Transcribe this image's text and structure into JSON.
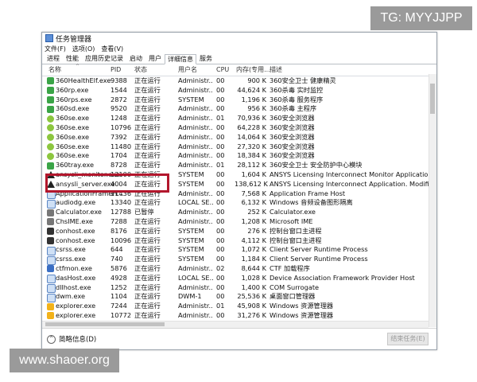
{
  "watermark_top": "TG: MYYJJPP",
  "watermark_bottom": "www.shaoer.org",
  "window": {
    "title": "任务管理器"
  },
  "menu": [
    "文件(F)",
    "选项(O)",
    "查看(V)"
  ],
  "tabs": [
    "进程",
    "性能",
    "应用历史记录",
    "启动",
    "用户",
    "详细信息",
    "服务"
  ],
  "active_tab": "详细信息",
  "columns": {
    "name": "名称",
    "pid": "PID",
    "status": "状态",
    "user": "用户名",
    "cpu": "CPU",
    "mem": "内存(专用...",
    "desc": "描述"
  },
  "rows": [
    {
      "icon": "shield-icon",
      "name": "360HealthElf.exe",
      "pid": "9388",
      "status": "正在运行",
      "user": "Administr...",
      "cpu": "00",
      "mem": "900 K",
      "desc": "360安全卫士 健康精灵"
    },
    {
      "icon": "shield-icon",
      "name": "360rp.exe",
      "pid": "1544",
      "status": "正在运行",
      "user": "Administr...",
      "cpu": "00",
      "mem": "44,624 K",
      "desc": "360杀毒 实时监控"
    },
    {
      "icon": "shield-icon",
      "name": "360rps.exe",
      "pid": "2872",
      "status": "正在运行",
      "user": "SYSTEM",
      "cpu": "00",
      "mem": "1,196 K",
      "desc": "360杀毒 服务程序"
    },
    {
      "icon": "shield-icon",
      "name": "360sd.exe",
      "pid": "9520",
      "status": "正在运行",
      "user": "Administr...",
      "cpu": "00",
      "mem": "956 K",
      "desc": "360杀毒 主程序"
    },
    {
      "icon": "browser-icon",
      "name": "360se.exe",
      "pid": "1248",
      "status": "正在运行",
      "user": "Administr...",
      "cpu": "01",
      "mem": "70,936 K",
      "desc": "360安全浏览器"
    },
    {
      "icon": "browser-icon",
      "name": "360se.exe",
      "pid": "10796",
      "status": "正在运行",
      "user": "Administr...",
      "cpu": "00",
      "mem": "64,228 K",
      "desc": "360安全浏览器"
    },
    {
      "icon": "browser-icon",
      "name": "360se.exe",
      "pid": "7392",
      "status": "正在运行",
      "user": "Administr...",
      "cpu": "00",
      "mem": "14,064 K",
      "desc": "360安全浏览器"
    },
    {
      "icon": "browser-icon",
      "name": "360se.exe",
      "pid": "11480",
      "status": "正在运行",
      "user": "Administr...",
      "cpu": "00",
      "mem": "27,320 K",
      "desc": "360安全浏览器"
    },
    {
      "icon": "browser-icon",
      "name": "360se.exe",
      "pid": "1704",
      "status": "正在运行",
      "user": "Administr...",
      "cpu": "00",
      "mem": "18,384 K",
      "desc": "360安全浏览器"
    },
    {
      "icon": "shield-icon",
      "name": "360tray.exe",
      "pid": "8728",
      "status": "正在运行",
      "user": "Administr...",
      "cpu": "01",
      "mem": "28,112 K",
      "desc": "360安全卫士 安全防护中心模块"
    },
    {
      "icon": "ansys-icon",
      "name": "ansysli_monitor.exe",
      "pid": "12100",
      "status": "正在运行",
      "user": "SYSTEM",
      "cpu": "00",
      "mem": "1,604 K",
      "desc": "ANSYS Licensing Interconnect Monitor Application.  Modif..."
    },
    {
      "icon": "ansys-icon",
      "name": "ansysli_server.exe",
      "pid": "4004",
      "status": "正在运行",
      "user": "SYSTEM",
      "cpu": "00",
      "mem": "138,612 K",
      "desc": "ANSYS Licensing Interconnect Application.  Modified for A..."
    },
    {
      "icon": "window-icon",
      "name": "ApplicationFrameH...",
      "pid": "11436",
      "status": "正在运行",
      "user": "Administr...",
      "cpu": "00",
      "mem": "7,568 K",
      "desc": "Application Frame Host"
    },
    {
      "icon": "window-icon",
      "name": "audiodg.exe",
      "pid": "13340",
      "status": "正在运行",
      "user": "LOCAL SE...",
      "cpu": "00",
      "mem": "6,132 K",
      "desc": "Windows 音频设备图形隔离"
    },
    {
      "icon": "calculator-icon",
      "name": "Calculator.exe",
      "pid": "12788",
      "status": "已暂停",
      "user": "Administr...",
      "cpu": "00",
      "mem": "252 K",
      "desc": "Calculator.exe"
    },
    {
      "icon": "gear-icon",
      "name": "ChsIME.exe",
      "pid": "7288",
      "status": "正在运行",
      "user": "Administr...",
      "cpu": "00",
      "mem": "1,208 K",
      "desc": "Microsoft IME"
    },
    {
      "icon": "console-icon",
      "name": "conhost.exe",
      "pid": "8176",
      "status": "正在运行",
      "user": "SYSTEM",
      "cpu": "00",
      "mem": "276 K",
      "desc": "控制台窗口主进程"
    },
    {
      "icon": "console-icon",
      "name": "conhost.exe",
      "pid": "10096",
      "status": "正在运行",
      "user": "SYSTEM",
      "cpu": "00",
      "mem": "4,112 K",
      "desc": "控制台窗口主进程"
    },
    {
      "icon": "window-icon",
      "name": "csrss.exe",
      "pid": "644",
      "status": "正在运行",
      "user": "SYSTEM",
      "cpu": "00",
      "mem": "1,072 K",
      "desc": "Client Server Runtime Process"
    },
    {
      "icon": "window-icon",
      "name": "csrss.exe",
      "pid": "740",
      "status": "正在运行",
      "user": "SYSTEM",
      "cpu": "00",
      "mem": "1,184 K",
      "desc": "Client Server Runtime Process"
    },
    {
      "icon": "pen-icon",
      "name": "ctfmon.exe",
      "pid": "5876",
      "status": "正在运行",
      "user": "Administr...",
      "cpu": "02",
      "mem": "8,644 K",
      "desc": "CTF 加载程序"
    },
    {
      "icon": "window-icon",
      "name": "dasHost.exe",
      "pid": "4928",
      "status": "正在运行",
      "user": "LOCAL SE...",
      "cpu": "00",
      "mem": "1,028 K",
      "desc": "Device Association Framework Provider Host"
    },
    {
      "icon": "window-icon",
      "name": "dllhost.exe",
      "pid": "1252",
      "status": "正在运行",
      "user": "Administr...",
      "cpu": "00",
      "mem": "1,400 K",
      "desc": "COM Surrogate"
    },
    {
      "icon": "window-icon",
      "name": "dwm.exe",
      "pid": "1104",
      "status": "正在运行",
      "user": "DWM-1",
      "cpu": "00",
      "mem": "25,536 K",
      "desc": "桌面窗口管理器"
    },
    {
      "icon": "folder-icon",
      "name": "explorer.exe",
      "pid": "7244",
      "status": "正在运行",
      "user": "Administr...",
      "cpu": "01",
      "mem": "45,908 K",
      "desc": "Windows 资源管理器"
    },
    {
      "icon": "folder-icon",
      "name": "explorer.exe",
      "pid": "10772",
      "status": "正在运行",
      "user": "Administr...",
      "cpu": "00",
      "mem": "31,276 K",
      "desc": "Windows 资源管理器"
    }
  ],
  "footer": {
    "summary": "简略信息(D)",
    "end_task": "结束任务(E)"
  }
}
